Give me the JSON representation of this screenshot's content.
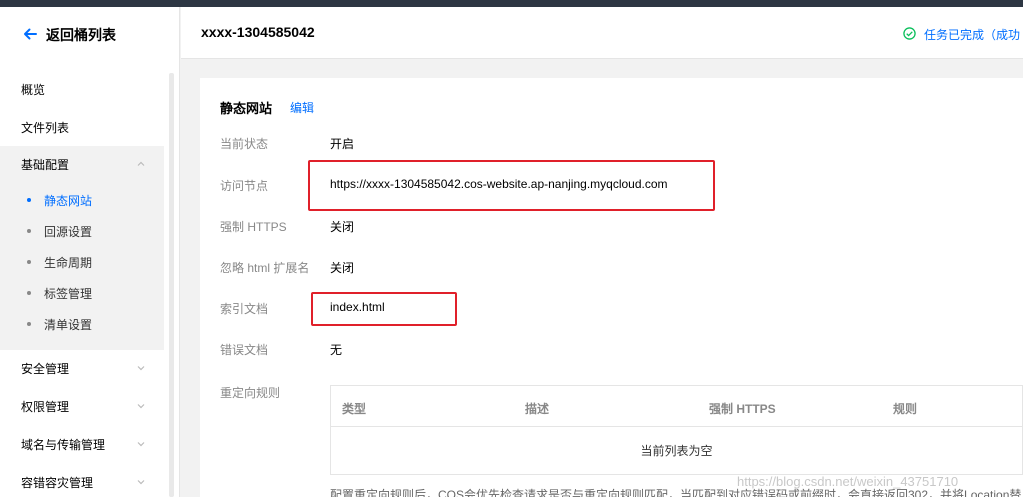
{
  "sidebar": {
    "back_label": "返回桶列表",
    "items": [
      {
        "label": "概览"
      },
      {
        "label": "文件列表"
      },
      {
        "label": "基础配置"
      },
      {
        "label": "安全管理"
      },
      {
        "label": "权限管理"
      },
      {
        "label": "域名与传输管理"
      },
      {
        "label": "容错容灾管理"
      }
    ],
    "sub_items": [
      {
        "label": "静态网站",
        "active": true
      },
      {
        "label": "回源设置"
      },
      {
        "label": "生命周期"
      },
      {
        "label": "标签管理"
      },
      {
        "label": "清单设置"
      }
    ]
  },
  "header": {
    "bucket_name": "xxxx-1304585042",
    "task_status": "任务已完成（成功"
  },
  "card": {
    "title": "静态网站",
    "edit_label": "编辑",
    "rows": [
      {
        "label": "当前状态",
        "value": "开启"
      },
      {
        "label": "访问节点",
        "value": "https://xxxx-1304585042.cos-website.ap-nanjing.myqcloud.com"
      },
      {
        "label": "强制 HTTPS",
        "value": "关闭"
      },
      {
        "label": "忽略 html 扩展名",
        "value": "关闭"
      },
      {
        "label": "索引文档",
        "value": "index.html"
      },
      {
        "label": "错误文档",
        "value": "无"
      }
    ],
    "redirect": {
      "label": "重定向规则",
      "columns": [
        "类型",
        "描述",
        "强制 HTTPS",
        "规则"
      ],
      "empty_text": "当前列表为空"
    },
    "footnote": "配置重定向规则后，COS会优先检查请求是否与重定向规则匹配，当匹配到对应错误码或前缀时，会直接返回302，并将Location替"
  },
  "watermark": "https://blog.csdn.net/weixin_43751710",
  "colors": {
    "accent": "#006eff",
    "highlight": "#e0202a",
    "success": "#0abf5b"
  }
}
